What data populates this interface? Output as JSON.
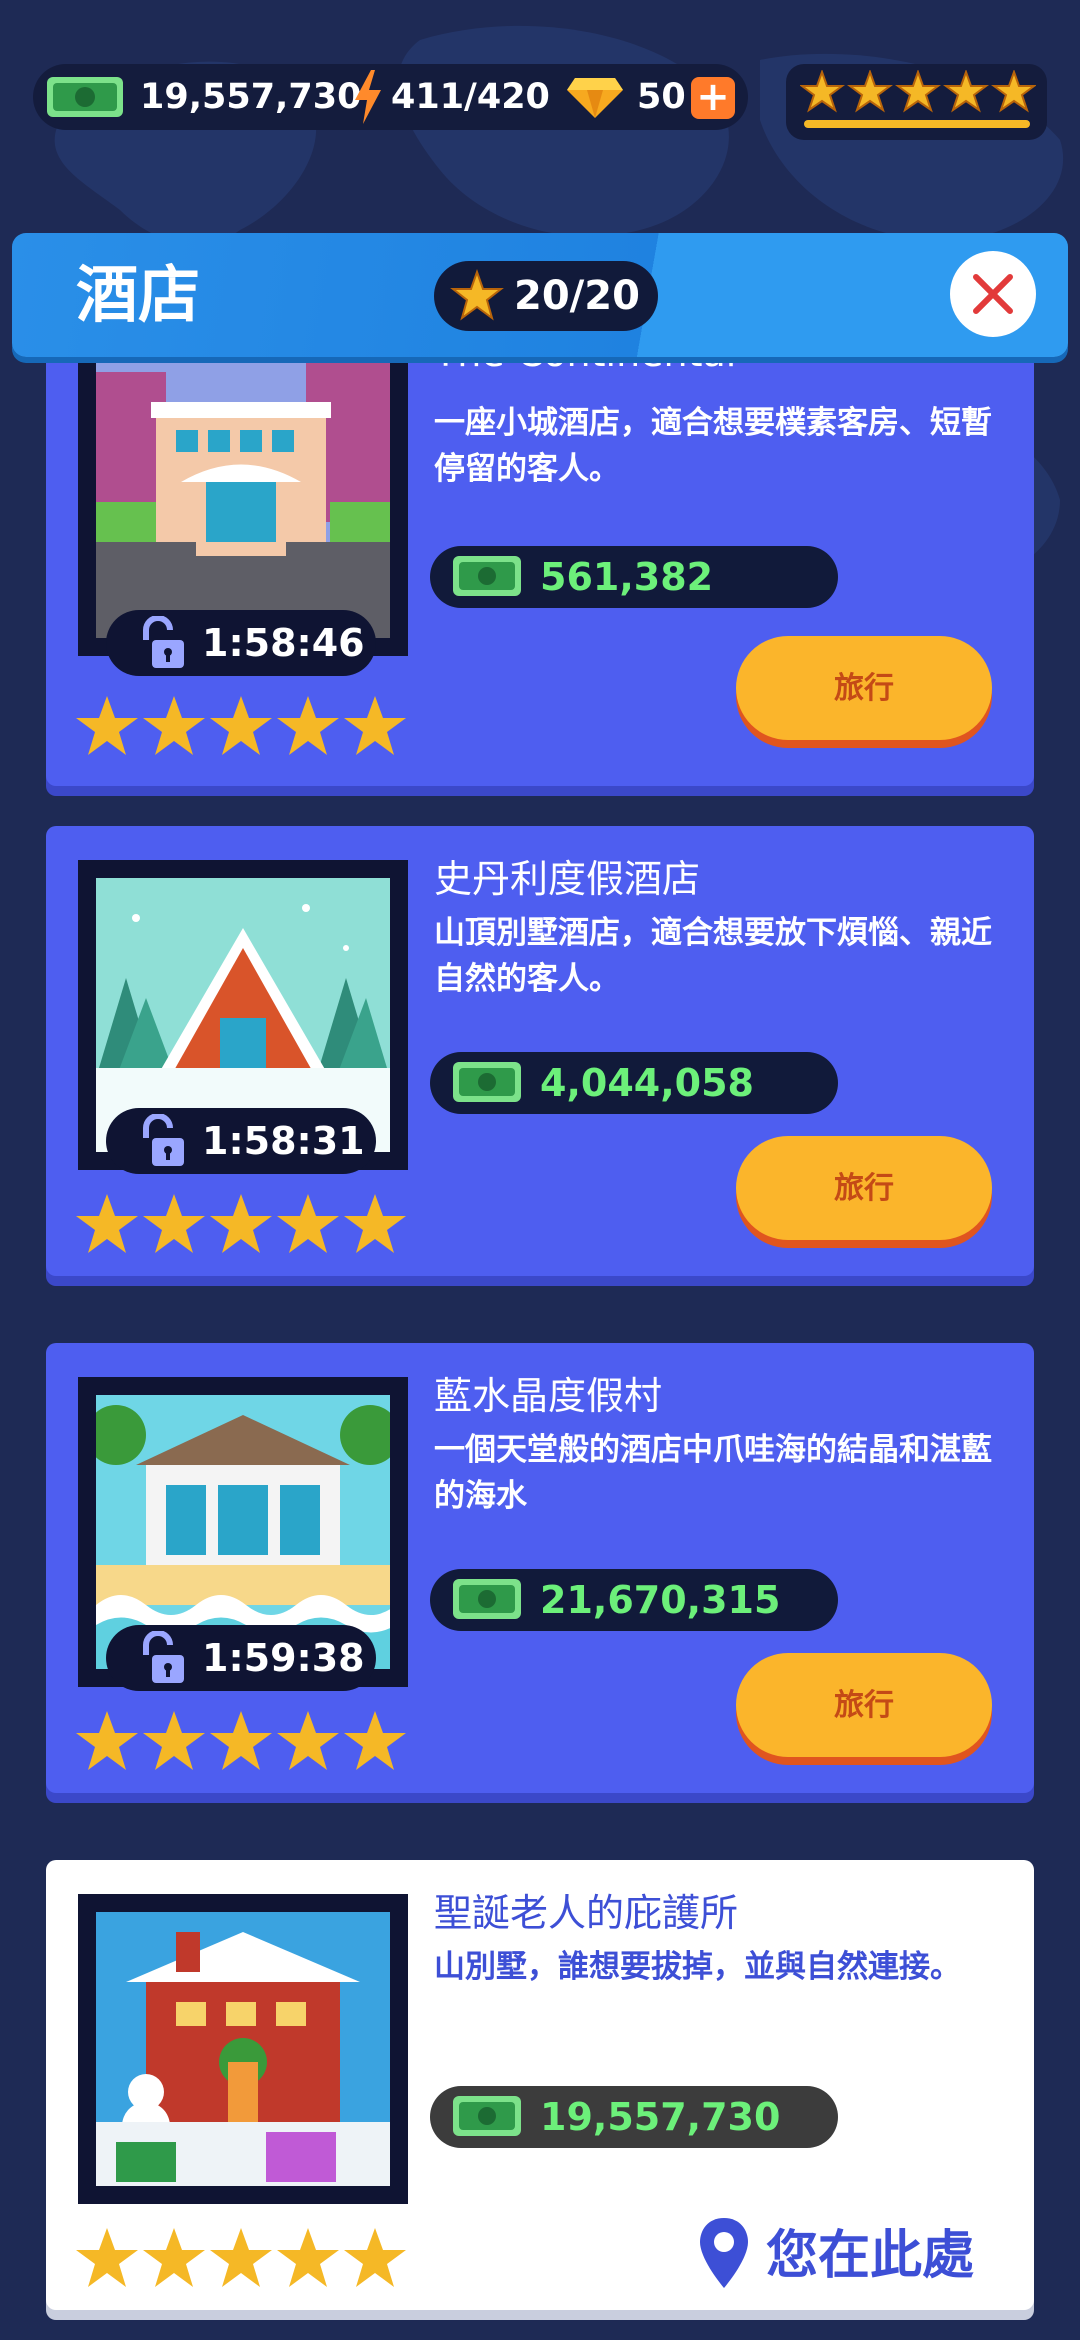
{
  "hud": {
    "cash": "19,557,730",
    "energy": "411/420",
    "gems": "50",
    "plus_symbol": "+",
    "rating_icon": "five-star-rating"
  },
  "banner": {
    "title": "酒店",
    "score": "20/20"
  },
  "hotels": [
    {
      "name": "The Continental",
      "description": "一座小城酒店，適合想要樸素客房、短暫停留的客人。",
      "price": "561,382",
      "timer": "1:58:46",
      "rating": 5,
      "action": "旅行"
    },
    {
      "name": "史丹利度假酒店",
      "description": "山頂別墅酒店，適合想要放下煩惱、親近自然的客人。",
      "price": "4,044,058",
      "timer": "1:58:31",
      "rating": 5,
      "action": "旅行"
    },
    {
      "name": "藍水晶度假村",
      "description": "一個天堂般的酒店中爪哇海的結晶和湛藍的海水",
      "price": "21,670,315",
      "timer": "1:59:38",
      "rating": 5,
      "action": "旅行"
    },
    {
      "name": "聖誕老人的庇護所",
      "description": "山別墅，誰想要拔掉，並與自然連接。",
      "price": "19,557,730",
      "rating": 5,
      "status": "您在此處"
    }
  ],
  "colors": {
    "background": "#1e2a55",
    "card": "#4e5ef0",
    "current_card": "#ffffff",
    "button": "#fbb52b",
    "price_text": "#6cf07a",
    "banner": "#2a8fe8"
  }
}
